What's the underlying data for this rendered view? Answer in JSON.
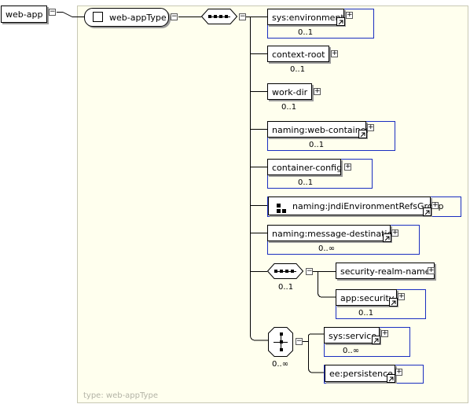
{
  "root": {
    "name": "web-app"
  },
  "type": {
    "name": "web-appType",
    "footer": "type: web-appType"
  },
  "sequence_children": [
    {
      "name": "sys:environment",
      "occurs": "0..1"
    },
    {
      "name": "context-root",
      "occurs": "0..1"
    },
    {
      "name": "work-dir",
      "occurs": "0..1"
    },
    {
      "name": "naming:web-container",
      "occurs": "0..1"
    },
    {
      "name": "container-config",
      "occurs": "0..1"
    },
    {
      "name": "naming:jndiEnvironmentRefsGroup",
      "occurs": ""
    },
    {
      "name": "naming:message-destination",
      "occurs": "0..∞"
    }
  ],
  "security_sequence": {
    "occurs": "0..1",
    "children": [
      {
        "name": "security-realm-name",
        "occurs": ""
      },
      {
        "name": "app:security",
        "occurs": "0..1"
      }
    ]
  },
  "choice": {
    "occurs": "0..∞",
    "children": [
      {
        "name": "sys:service",
        "occurs": "0..∞"
      },
      {
        "name": "ee:persistence",
        "occurs": ""
      }
    ]
  },
  "colors": {
    "panel_bg": "#ffffee",
    "border_blue": "#1a2ec0",
    "connector": "#000000"
  },
  "icons": [
    "expand-icon",
    "collapse-icon",
    "reference-arrow-icon",
    "sequence-compositor-icon",
    "choice-compositor-icon",
    "group-icon"
  ]
}
